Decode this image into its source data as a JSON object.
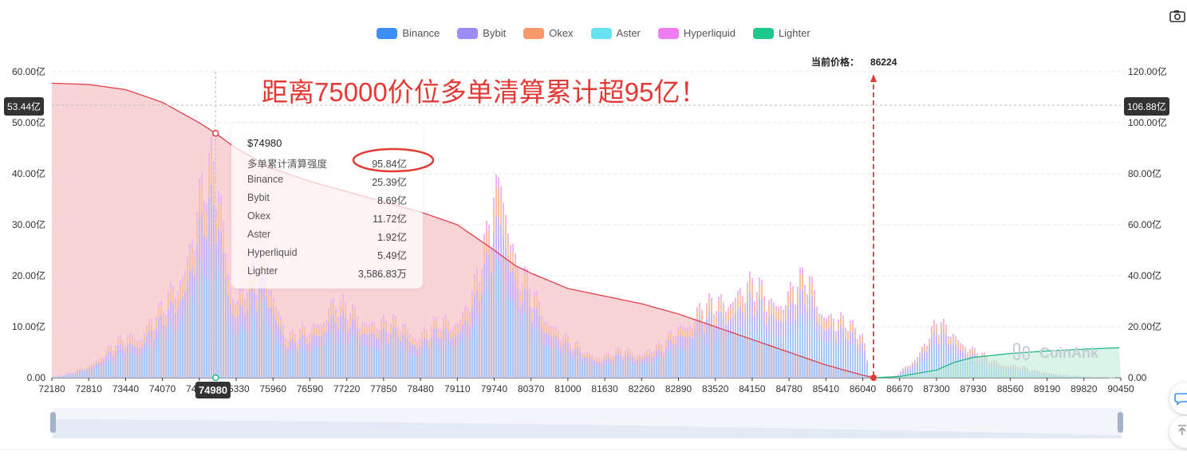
{
  "chart_data": {
    "type": "bar",
    "legend": [
      "Binance",
      "Bybit",
      "Okex",
      "Aster",
      "Hyperliquid",
      "Lighter"
    ],
    "colors": {
      "Binance": "#3b8ff7",
      "Bybit": "#9b8cf7",
      "Okex": "#f7986b",
      "Aster": "#67e3f2",
      "Hyperliquid": "#f07cf2",
      "Lighter": "#1fc98b"
    },
    "x_ticks": [
      "72180",
      "72810",
      "73440",
      "74070",
      "74700",
      "75330",
      "75960",
      "76590",
      "77220",
      "77850",
      "78480",
      "79110",
      "79740",
      "80370",
      "81000",
      "81630",
      "82260",
      "82890",
      "83520",
      "84150",
      "84780",
      "85410",
      "86040",
      "86670",
      "87300",
      "87930",
      "88560",
      "89190",
      "89820",
      "90450"
    ],
    "x_range": [
      72180,
      90450
    ],
    "ylim_left": [
      0,
      60
    ],
    "ylim_right": [
      0,
      120
    ],
    "y_left_ticks": [
      "0.00",
      "10.00亿",
      "20.00亿",
      "30.00亿",
      "40.00亿",
      "50.00亿",
      "60.00亿"
    ],
    "y_right_ticks": [
      "0.00",
      "20.00亿",
      "40.00亿",
      "60.00亿",
      "80.00亿",
      "100.00亿",
      "120.00亿"
    ],
    "bar_profile": [
      [
        72180,
        0.3
      ],
      [
        72500,
        1.0
      ],
      [
        72810,
        3
      ],
      [
        73100,
        6
      ],
      [
        73440,
        9
      ],
      [
        73700,
        11
      ],
      [
        74070,
        15
      ],
      [
        74400,
        25
      ],
      [
        74600,
        36
      ],
      [
        74800,
        43
      ],
      [
        74980,
        47
      ],
      [
        75150,
        30
      ],
      [
        75330,
        18
      ],
      [
        75600,
        22
      ],
      [
        75800,
        27
      ],
      [
        75960,
        20
      ],
      [
        76200,
        9
      ],
      [
        76590,
        11
      ],
      [
        76900,
        17
      ],
      [
        77220,
        15
      ],
      [
        77500,
        14
      ],
      [
        77850,
        12
      ],
      [
        78200,
        12
      ],
      [
        78480,
        10
      ],
      [
        78800,
        12
      ],
      [
        79110,
        14
      ],
      [
        79400,
        20
      ],
      [
        79600,
        30
      ],
      [
        79740,
        44
      ],
      [
        79850,
        49
      ],
      [
        79950,
        42
      ],
      [
        80100,
        24
      ],
      [
        80370,
        19
      ],
      [
        80600,
        15
      ],
      [
        81000,
        8
      ],
      [
        81300,
        6
      ],
      [
        81630,
        5
      ],
      [
        81900,
        6
      ],
      [
        82260,
        6
      ],
      [
        82600,
        7
      ],
      [
        82890,
        12
      ],
      [
        83200,
        15
      ],
      [
        83520,
        16
      ],
      [
        83800,
        20
      ],
      [
        84150,
        20
      ],
      [
        84450,
        18
      ],
      [
        84780,
        19
      ],
      [
        85100,
        22
      ],
      [
        85410,
        15
      ],
      [
        85700,
        12
      ],
      [
        86040,
        10
      ],
      [
        86150,
        0
      ],
      [
        86550,
        0
      ],
      [
        86800,
        3
      ],
      [
        87000,
        6
      ],
      [
        87300,
        12
      ],
      [
        87600,
        10
      ],
      [
        87930,
        6
      ],
      [
        88200,
        4
      ],
      [
        88560,
        3
      ],
      [
        89000,
        1.5
      ],
      [
        89190,
        1.2
      ],
      [
        89500,
        0.6
      ],
      [
        89820,
        0.3
      ],
      [
        90450,
        0
      ]
    ],
    "long_cumulative_curve": [
      [
        72180,
        115.5
      ],
      [
        72810,
        115
      ],
      [
        73440,
        113
      ],
      [
        74070,
        108
      ],
      [
        74700,
        100
      ],
      [
        74980,
        95.84
      ],
      [
        75330,
        90
      ],
      [
        75960,
        82
      ],
      [
        76590,
        77
      ],
      [
        77220,
        73
      ],
      [
        77850,
        69
      ],
      [
        78480,
        65
      ],
      [
        79110,
        60
      ],
      [
        79740,
        50
      ],
      [
        80100,
        44
      ],
      [
        80370,
        41
      ],
      [
        81000,
        35
      ],
      [
        81630,
        32
      ],
      [
        82260,
        29
      ],
      [
        82890,
        25
      ],
      [
        83520,
        20
      ],
      [
        84150,
        15
      ],
      [
        84780,
        10
      ],
      [
        85410,
        5
      ],
      [
        86040,
        1
      ],
      [
        86224,
        0
      ]
    ],
    "short_cumulative_curve": [
      [
        86224,
        0
      ],
      [
        86670,
        0.5
      ],
      [
        87300,
        3
      ],
      [
        87600,
        6
      ],
      [
        87930,
        8
      ],
      [
        88560,
        9.5
      ],
      [
        89190,
        10.5
      ],
      [
        89820,
        11.2
      ],
      [
        90450,
        11.8
      ]
    ],
    "current_price_label": "当前价格：",
    "current_price": "86224",
    "current_price_value": 86224,
    "cursor_price": "74980",
    "cursor_price_value": 74980,
    "crosshair_left_value": 53.44,
    "crosshair_left_label": "53.44亿",
    "crosshair_right_label": "106.88亿",
    "headline": "距离75000价位多单清算累计超95亿！",
    "tooltip": {
      "title": "$74980",
      "rows": [
        {
          "label": "多单累计清算强度",
          "value": "95.84亿"
        },
        {
          "label": "Binance",
          "value": "25.39亿"
        },
        {
          "label": "Bybit",
          "value": "8.69亿"
        },
        {
          "label": "Okex",
          "value": "11.72亿"
        },
        {
          "label": "Aster",
          "value": "1.92亿"
        },
        {
          "label": "Hyperliquid",
          "value": "5.49亿"
        },
        {
          "label": "Lighter",
          "value": "3,586.83万"
        }
      ]
    },
    "watermark": "CoinAnk"
  }
}
